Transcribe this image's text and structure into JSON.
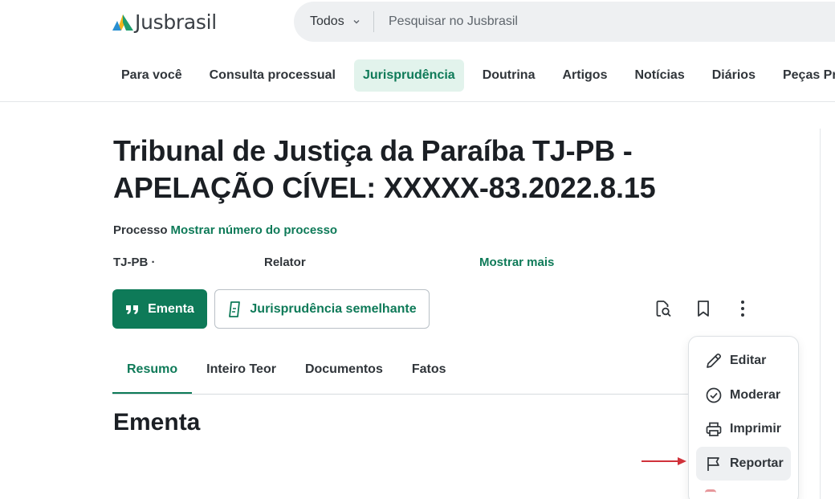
{
  "header": {
    "logo_text": "Jusbrasil",
    "search": {
      "scope": "Todos",
      "placeholder": "Pesquisar no Jusbrasil"
    },
    "nav": [
      {
        "label": "Para você",
        "active": false
      },
      {
        "label": "Consulta processual",
        "active": false
      },
      {
        "label": "Jurisprudência",
        "active": true
      },
      {
        "label": "Doutrina",
        "active": false
      },
      {
        "label": "Artigos",
        "active": false
      },
      {
        "label": "Notícias",
        "active": false
      },
      {
        "label": "Diários",
        "active": false
      },
      {
        "label": "Peças Pro",
        "active": false
      }
    ]
  },
  "document": {
    "title_line1": "Tribunal de Justiça da Paraíba TJ-PB -",
    "title_line2": "APELAÇÃO CÍVEL: XXXXX-83.2022.8.15",
    "process_label": "Processo",
    "process_link": "Mostrar número do processo",
    "court": "TJ-PB ·",
    "rapporteur_label": "Relator",
    "show_more": "Mostrar mais"
  },
  "actions": {
    "ementa_label": "Ementa",
    "similar_label": "Jurisprudência semelhante",
    "icons": [
      "search-document-icon",
      "bookmark-icon",
      "more-vertical-icon"
    ]
  },
  "tabs": [
    {
      "label": "Resumo",
      "active": true
    },
    {
      "label": "Inteiro Teor",
      "active": false
    },
    {
      "label": "Documentos",
      "active": false
    },
    {
      "label": "Fatos",
      "active": false
    }
  ],
  "section_title": "Ementa",
  "menu": {
    "items": [
      {
        "label": "Editar",
        "icon": "pencil-icon"
      },
      {
        "label": "Moderar",
        "icon": "check-circle-icon"
      },
      {
        "label": "Imprimir",
        "icon": "printer-icon"
      },
      {
        "label": "Reportar",
        "icon": "flag-icon",
        "highlighted": true
      }
    ]
  },
  "colors": {
    "brand_green": "#0e7a58",
    "active_nav_bg": "#e2f3ec",
    "annotation_arrow": "#d0323a"
  }
}
